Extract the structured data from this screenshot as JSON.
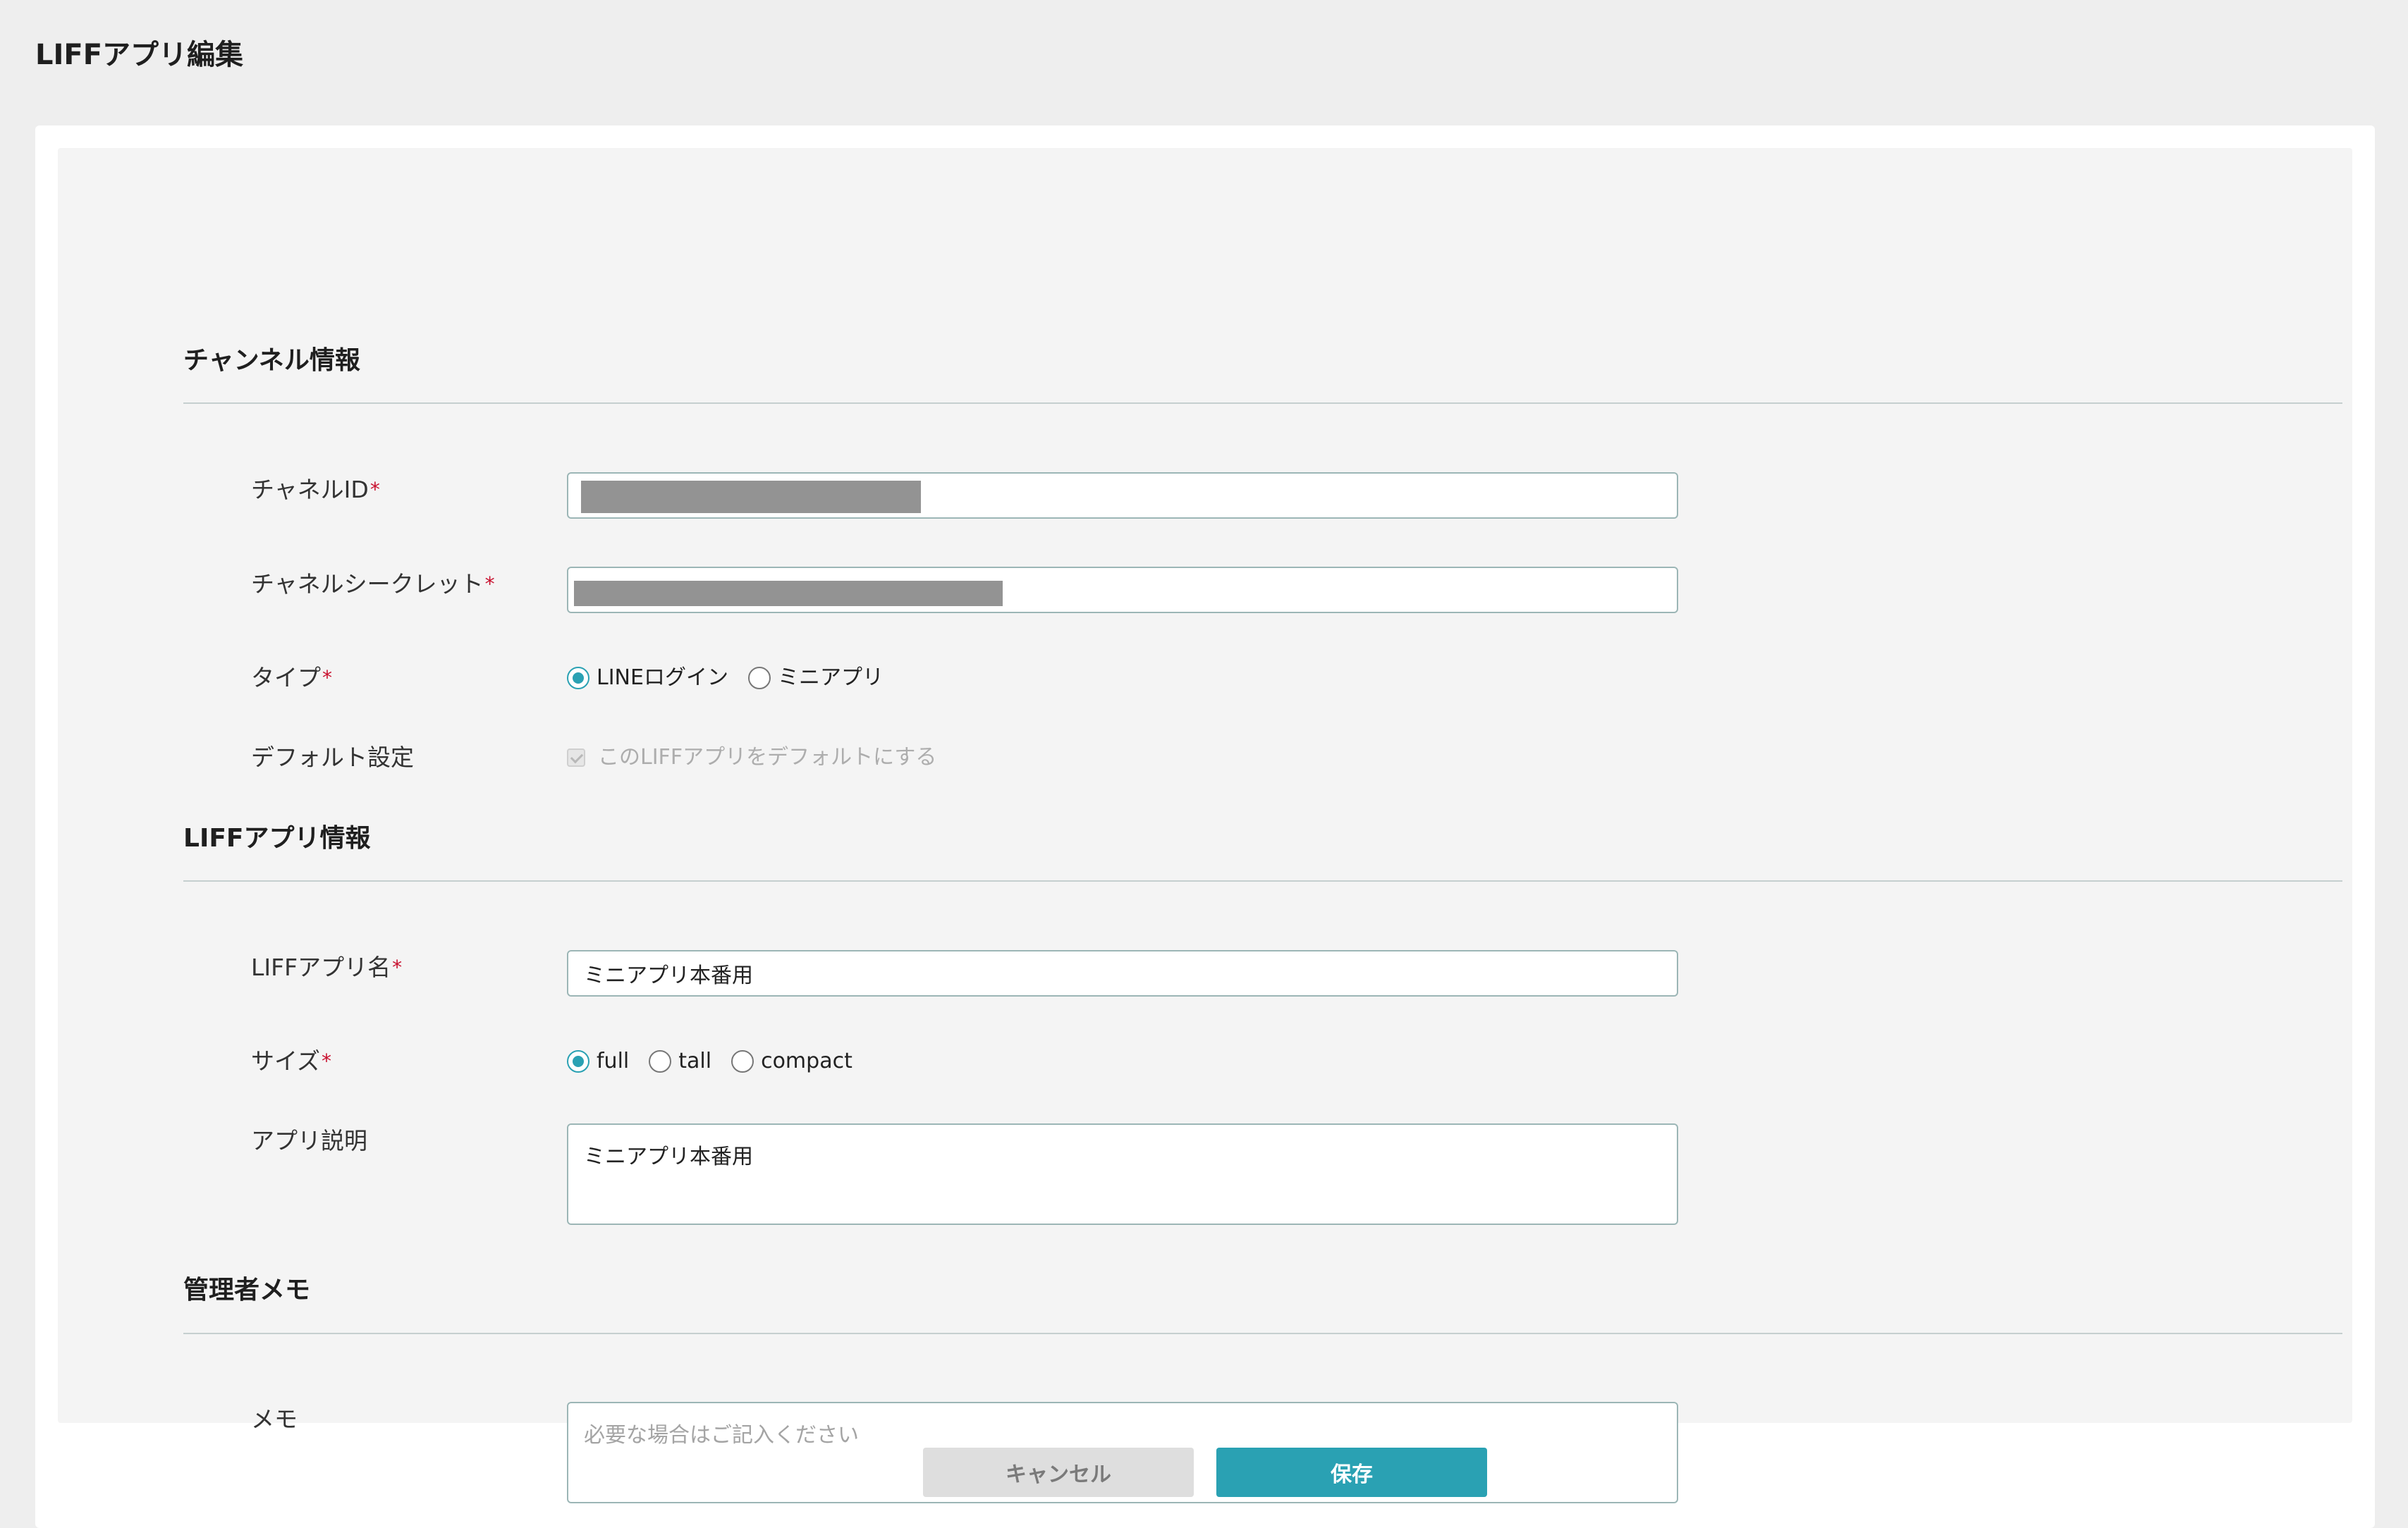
{
  "page": {
    "title": "LIFFアプリ編集"
  },
  "sections": {
    "channel": {
      "title": "チャンネル情報",
      "channel_id_label": "チャネルID",
      "channel_secret_label": "チャネルシークレット",
      "type_label": "タイプ",
      "type_options": [
        "LINEログイン",
        "ミニアプリ"
      ],
      "type_selected": "LINEログイン",
      "default_label": "デフォルト設定",
      "default_checkbox_label": "このLIFFアプリをデフォルトにする",
      "default_checked": true,
      "default_disabled": true
    },
    "liff": {
      "title": "LIFFアプリ情報",
      "name_label": "LIFFアプリ名",
      "name_value": "ミニアプリ本番用",
      "size_label": "サイズ",
      "size_options": [
        "full",
        "tall",
        "compact"
      ],
      "size_selected": "full",
      "description_label": "アプリ説明",
      "description_value": "ミニアプリ本番用"
    },
    "admin": {
      "title": "管理者メモ",
      "memo_label": "メモ",
      "memo_value": "",
      "memo_placeholder": "必要な場合はご記入ください"
    }
  },
  "required_mark": "*",
  "buttons": {
    "cancel": "キャンセル",
    "save": "保存"
  },
  "colors": {
    "accent": "#2aa1b3",
    "required": "#c8102e",
    "input_border": "#9cb6b6"
  }
}
